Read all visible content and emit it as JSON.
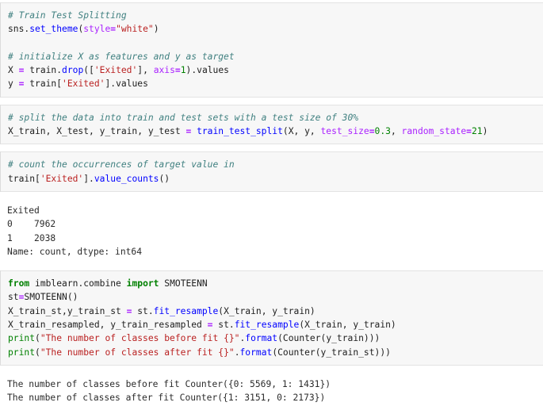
{
  "notebook": {
    "kind": "jupyter-notebook-code-and-output",
    "colors": {
      "cell_background": "#f7f7f7",
      "cell_border": "#e3e3e3",
      "output_background": "#ffffff",
      "text": "#202020",
      "comment": "#408080",
      "keyword": "#008000",
      "function": "#0000ff",
      "string": "#ba2121",
      "operator": "#aa22ff",
      "number": "#008000",
      "kwarg": "#aa22ff"
    },
    "blocks": [
      {
        "type": "code",
        "name": "train-test-splitting-cell",
        "lines": [
          {
            "tokens": [
              {
                "t": "# Train Test Splitting",
                "c": "c"
              }
            ]
          },
          {
            "tokens": [
              {
                "t": "sns",
                "c": "n"
              },
              {
                "t": ".",
                "c": "p"
              },
              {
                "t": "set_theme",
                "c": "nf"
              },
              {
                "t": "(",
                "c": "p"
              },
              {
                "t": "style",
                "c": "kw"
              },
              {
                "t": "=",
                "c": "o"
              },
              {
                "t": "\"white\"",
                "c": "s"
              },
              {
                "t": ")",
                "c": "p"
              }
            ]
          },
          {
            "tokens": [
              {
                "t": " ",
                "c": "n"
              }
            ]
          },
          {
            "tokens": [
              {
                "t": "# initialize X as features and y as target",
                "c": "c"
              }
            ]
          },
          {
            "tokens": [
              {
                "t": "X ",
                "c": "n"
              },
              {
                "t": "=",
                "c": "o"
              },
              {
                "t": " train",
                "c": "n"
              },
              {
                "t": ".",
                "c": "p"
              },
              {
                "t": "drop",
                "c": "nf"
              },
              {
                "t": "([",
                "c": "p"
              },
              {
                "t": "'Exited'",
                "c": "s"
              },
              {
                "t": "], ",
                "c": "p"
              },
              {
                "t": "axis",
                "c": "kw"
              },
              {
                "t": "=",
                "c": "o"
              },
              {
                "t": "1",
                "c": "m"
              },
              {
                "t": ").values",
                "c": "p"
              }
            ]
          },
          {
            "tokens": [
              {
                "t": "y ",
                "c": "n"
              },
              {
                "t": "=",
                "c": "o"
              },
              {
                "t": " train",
                "c": "n"
              },
              {
                "t": "[",
                "c": "p"
              },
              {
                "t": "'Exited'",
                "c": "s"
              },
              {
                "t": "].values",
                "c": "p"
              }
            ]
          }
        ]
      },
      {
        "type": "code",
        "name": "train-test-split-call-cell",
        "lines": [
          {
            "tokens": [
              {
                "t": "# split the data into train and test sets with a test size of 30%",
                "c": "c"
              }
            ]
          },
          {
            "tokens": [
              {
                "t": "X_train, X_test, y_train, y_test ",
                "c": "n"
              },
              {
                "t": "=",
                "c": "o"
              },
              {
                "t": " train_test_split",
                "c": "nf"
              },
              {
                "t": "(X, y, ",
                "c": "p"
              },
              {
                "t": "test_size",
                "c": "kw"
              },
              {
                "t": "=",
                "c": "o"
              },
              {
                "t": "0.3",
                "c": "m"
              },
              {
                "t": ", ",
                "c": "p"
              },
              {
                "t": "random_state",
                "c": "kw"
              },
              {
                "t": "=",
                "c": "o"
              },
              {
                "t": "21",
                "c": "m"
              },
              {
                "t": ")",
                "c": "p"
              }
            ]
          }
        ]
      },
      {
        "type": "code",
        "name": "value-counts-cell",
        "lines": [
          {
            "tokens": [
              {
                "t": "# count the occurrences of target value in",
                "c": "c"
              }
            ]
          },
          {
            "tokens": [
              {
                "t": "train",
                "c": "n"
              },
              {
                "t": "[",
                "c": "p"
              },
              {
                "t": "'Exited'",
                "c": "s"
              },
              {
                "t": "].",
                "c": "p"
              },
              {
                "t": "value_counts",
                "c": "nf"
              },
              {
                "t": "()",
                "c": "p"
              }
            ]
          }
        ]
      },
      {
        "type": "output",
        "name": "value-counts-output",
        "lines": [
          "Exited",
          "0    7962",
          "1    2038",
          "Name: count, dtype: int64"
        ]
      },
      {
        "type": "code",
        "name": "smoteenn-resample-cell",
        "lines": [
          {
            "tokens": [
              {
                "t": "from",
                "c": "k"
              },
              {
                "t": " imblearn",
                "c": "n"
              },
              {
                "t": ".",
                "c": "p"
              },
              {
                "t": "combine ",
                "c": "n"
              },
              {
                "t": "import",
                "c": "k"
              },
              {
                "t": " SMOTEENN",
                "c": "n"
              }
            ]
          },
          {
            "tokens": [
              {
                "t": "st",
                "c": "n"
              },
              {
                "t": "=",
                "c": "o"
              },
              {
                "t": "SMOTEENN",
                "c": "n"
              },
              {
                "t": "()",
                "c": "p"
              }
            ]
          },
          {
            "tokens": [
              {
                "t": "X_train_st,y_train_st ",
                "c": "n"
              },
              {
                "t": "=",
                "c": "o"
              },
              {
                "t": " st",
                "c": "n"
              },
              {
                "t": ".",
                "c": "p"
              },
              {
                "t": "fit_resample",
                "c": "nf"
              },
              {
                "t": "(X_train, y_train)",
                "c": "p"
              }
            ]
          },
          {
            "tokens": [
              {
                "t": "X_train_resampled, y_train_resampled ",
                "c": "n"
              },
              {
                "t": "=",
                "c": "o"
              },
              {
                "t": " st",
                "c": "n"
              },
              {
                "t": ".",
                "c": "p"
              },
              {
                "t": "fit_resample",
                "c": "nf"
              },
              {
                "t": "(X_train, y_train)",
                "c": "p"
              }
            ]
          },
          {
            "tokens": [
              {
                "t": "print",
                "c": "nb"
              },
              {
                "t": "(",
                "c": "p"
              },
              {
                "t": "\"The number of classes before fit {}\"",
                "c": "s"
              },
              {
                "t": ".",
                "c": "p"
              },
              {
                "t": "format",
                "c": "nf"
              },
              {
                "t": "(Counter(y_train)))",
                "c": "p"
              }
            ]
          },
          {
            "tokens": [
              {
                "t": "print",
                "c": "nb"
              },
              {
                "t": "(",
                "c": "p"
              },
              {
                "t": "\"The number of classes after fit {}\"",
                "c": "s"
              },
              {
                "t": ".",
                "c": "p"
              },
              {
                "t": "format",
                "c": "nf"
              },
              {
                "t": "(Counter(y_train_st)))",
                "c": "p"
              }
            ]
          }
        ]
      },
      {
        "type": "output",
        "name": "class-counts-output",
        "lines": [
          "The number of classes before fit Counter({0: 5569, 1: 1431})",
          "The number of classes after fit Counter({1: 3151, 0: 2173})"
        ]
      }
    ]
  }
}
